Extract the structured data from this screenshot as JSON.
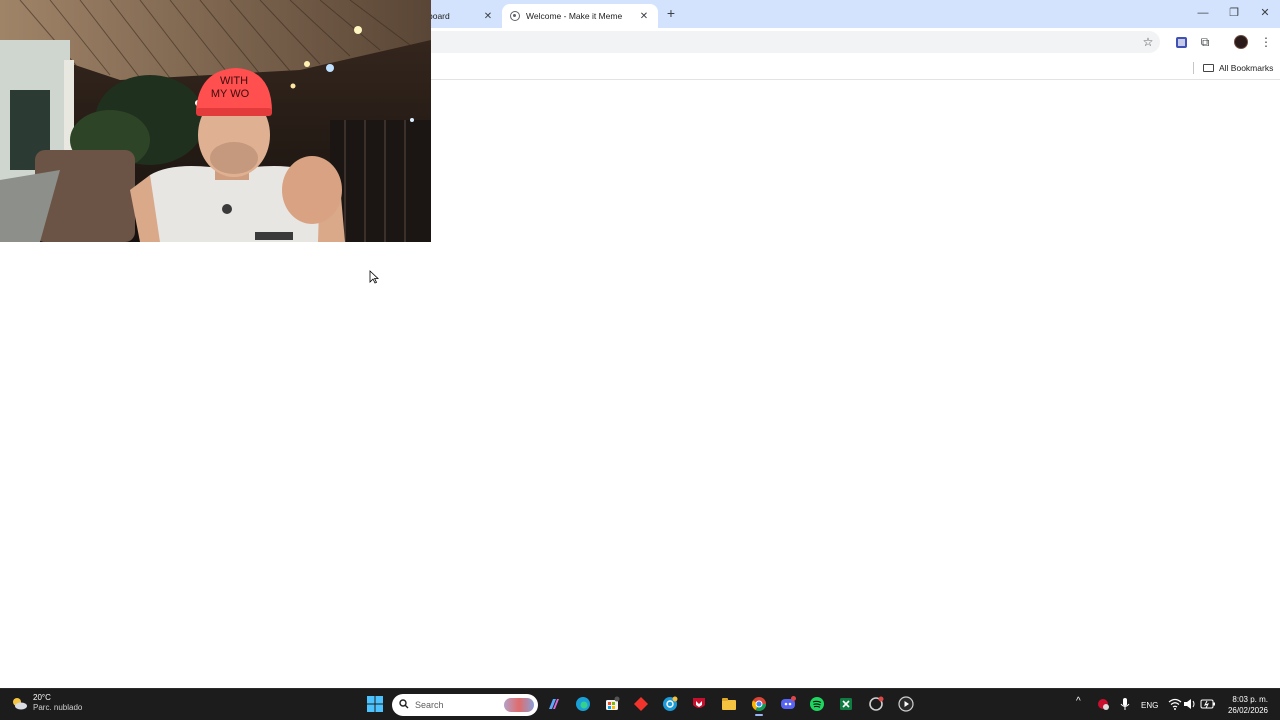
{
  "browser": {
    "tabs": [
      {
        "title": "board",
        "active": false
      },
      {
        "title": "Welcome - Make it Meme",
        "active": true
      }
    ],
    "close_glyph": "✕",
    "new_tab_glyph": "+",
    "window_controls": {
      "minimize": "—",
      "restore": "❐",
      "close": "✕"
    },
    "toolbar_icons": [
      "bookmark-star-icon",
      "extension-icon",
      "puzzle-icon",
      "profile-avatar",
      "kebab-menu-icon"
    ],
    "star_glyph": "☆",
    "menu_glyph": "⋮",
    "puzzle_glyph": "⧉",
    "bookmarks_bar": {
      "all_bookmarks_label": "All Bookmarks"
    }
  },
  "taskbar": {
    "weather": {
      "temp": "20°C",
      "condition": "Parc. nublado"
    },
    "search": {
      "placeholder": "Search"
    },
    "apps": [
      "start",
      "search",
      "copilot",
      "edge",
      "store",
      "red-diamond-app",
      "chatgpt-app",
      "mcafee",
      "file-explorer",
      "chrome",
      "discord",
      "spotify",
      "excel",
      "clipchamp-app",
      "media-player"
    ],
    "tray": {
      "overflow_glyph": "^",
      "language": "ENG"
    },
    "clock": {
      "time": "8:03 p. m.",
      "date": "26/02/2026"
    }
  },
  "colors": {
    "tabstrip": "#d3e3fd",
    "taskbar": "#1c1c1c",
    "accent": "#0b57d0"
  }
}
